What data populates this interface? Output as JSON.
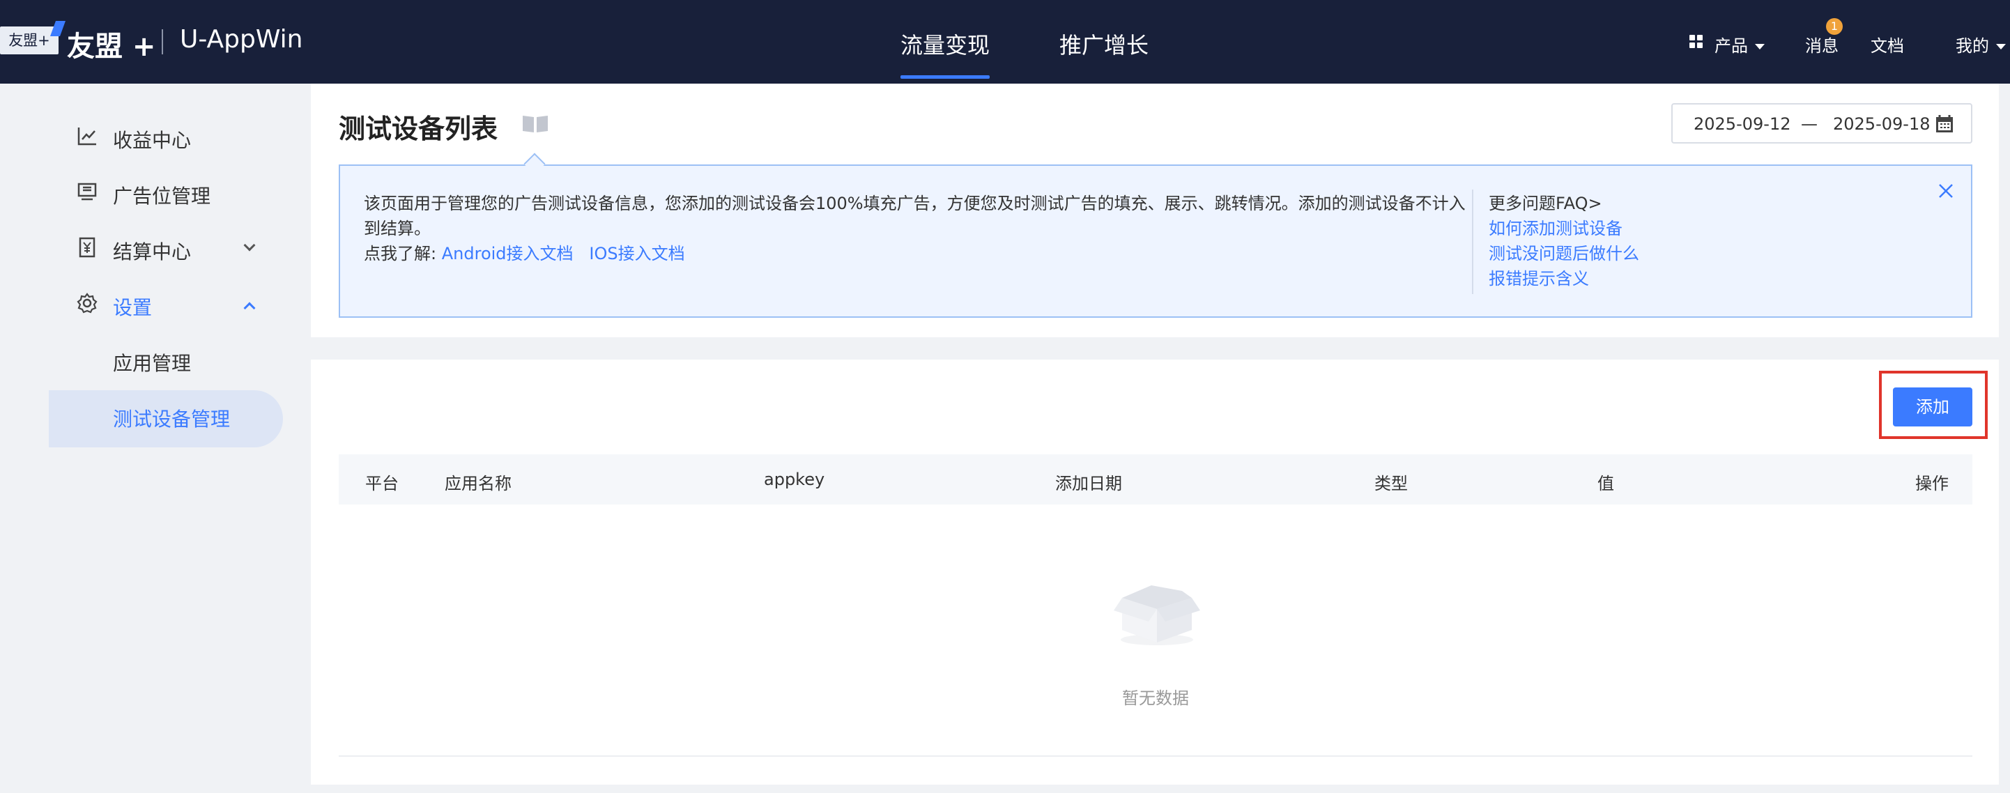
{
  "header": {
    "logo_tag": "友盟+",
    "logo_text": "友盟 +",
    "app_name": "U-AppWin",
    "tabs": [
      {
        "label": "流量变现",
        "active": true
      },
      {
        "label": "推广增长",
        "active": false
      }
    ],
    "right": {
      "products": "产品",
      "messages": "消息",
      "messages_badge": "1",
      "docs": "文档",
      "mine": "我的"
    }
  },
  "sidebar": {
    "items": [
      {
        "label": "收益中心",
        "icon": "line-chart-icon"
      },
      {
        "label": "广告位管理",
        "icon": "monitor-icon"
      },
      {
        "label": "结算中心",
        "icon": "yen-receipt-icon"
      },
      {
        "label": "设置",
        "icon": "gear-icon"
      }
    ],
    "sub_items": [
      {
        "label": "应用管理"
      },
      {
        "label": "测试设备管理",
        "active": true
      }
    ]
  },
  "page": {
    "title": "测试设备列表",
    "date_start": "2025-09-12",
    "date_sep": "—",
    "date_end": "2025-09-18"
  },
  "info": {
    "text": "该页面用于管理您的广告测试设备信息，您添加的测试设备会100%填充广告，方便您及时测试广告的填充、展示、跳转情况。添加的测试设备不计入到结算。",
    "learn_prefix": "点我了解:",
    "android_link": "Android接入文档",
    "ios_link": "IOS接入文档",
    "faq_title": "更多问题FAQ>",
    "faq_links": [
      "如何添加测试设备",
      "测试没问题后做什么",
      "报错提示含义"
    ]
  },
  "table": {
    "add_button": "添加",
    "columns": [
      "平台",
      "应用名称",
      "appkey",
      "添加日期",
      "类型",
      "值",
      "操作"
    ],
    "empty_text": "暂无数据"
  },
  "colors": {
    "topbar": "#18203a",
    "accent": "#3b7bff",
    "highlight_border": "#e0352b"
  }
}
